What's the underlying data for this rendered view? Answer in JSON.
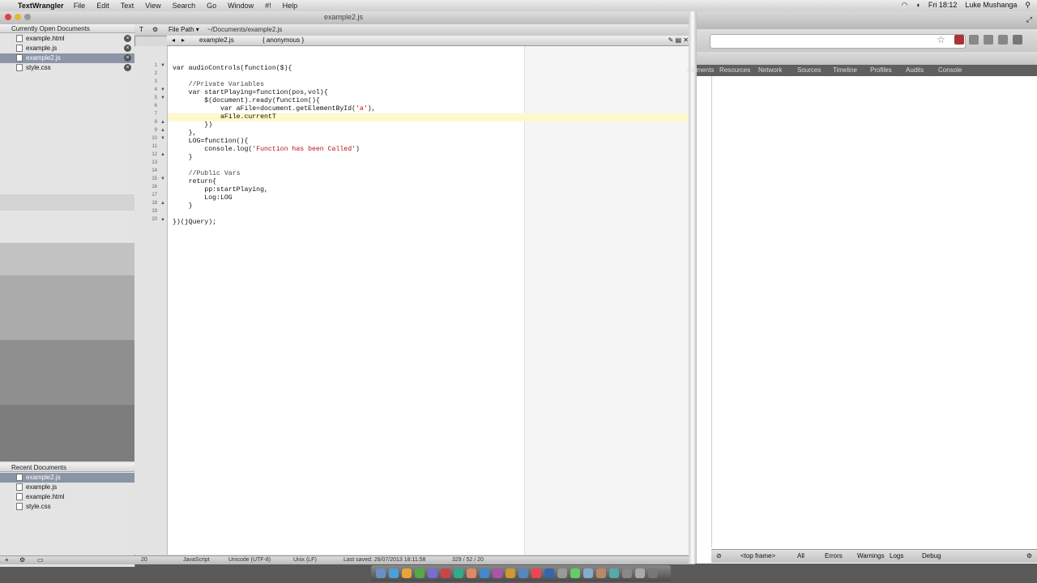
{
  "menubar": {
    "app_name": "TextWrangler",
    "items": [
      "File",
      "Edit",
      "Text",
      "View",
      "Search",
      "Go",
      "Window",
      "#!",
      "Help"
    ],
    "clock": "Fri 18:12",
    "user": "Luke Mushanga"
  },
  "window": {
    "title": "example2.js"
  },
  "sidebar": {
    "open_header": "Currently Open Documents",
    "open_docs": [
      {
        "name": "example.html",
        "selected": false
      },
      {
        "name": "example.js",
        "selected": false
      },
      {
        "name": "example2.js",
        "selected": true
      },
      {
        "name": "style.css",
        "selected": false
      }
    ],
    "recent_header": "Recent Documents",
    "recent_docs": [
      {
        "name": "example2.js",
        "selected": true
      },
      {
        "name": "example.js",
        "selected": false
      },
      {
        "name": "example.html",
        "selected": false
      },
      {
        "name": "style.css",
        "selected": false
      }
    ]
  },
  "toolbar": {
    "file_path_label": "File Path ▾",
    "file_path": "~/Documents/example2.js"
  },
  "navbar": {
    "file_menu": "example2.js",
    "function_menu": "{ anonymous }"
  },
  "editor": {
    "lines": [
      {
        "n": "1",
        "text": "var audioControls(function($){",
        "fold": "▼"
      },
      {
        "n": "2",
        "text": "",
        "fold": ""
      },
      {
        "n": "3",
        "text": "    //Private Variables",
        "fold": "",
        "cls": "cmt"
      },
      {
        "n": "4",
        "text": "    var startPlaying=function(pos,vol){",
        "fold": "▼"
      },
      {
        "n": "5",
        "text": "        $(document).ready(function(){",
        "fold": "▼"
      },
      {
        "n": "6",
        "text": "            var aFile=document.getElementById('a'),",
        "fold": ""
      },
      {
        "n": "7",
        "text": "            aFile.currentT",
        "fold": "",
        "hl": true
      },
      {
        "n": "8",
        "text": "        })",
        "fold": "▲"
      },
      {
        "n": "9",
        "text": "    },",
        "fold": "▲"
      },
      {
        "n": "10",
        "text": "    LOG=function(){",
        "fold": "▼"
      },
      {
        "n": "11",
        "text": "        console.log('Function has been Called')",
        "fold": ""
      },
      {
        "n": "12",
        "text": "    }",
        "fold": "▲"
      },
      {
        "n": "13",
        "text": "",
        "fold": ""
      },
      {
        "n": "14",
        "text": "    //Public Vars",
        "fold": "",
        "cls": "cmt"
      },
      {
        "n": "15",
        "text": "    return{",
        "fold": "▼"
      },
      {
        "n": "16",
        "text": "        pp:startPlaying,",
        "fold": ""
      },
      {
        "n": "17",
        "text": "        Log:LOG",
        "fold": ""
      },
      {
        "n": "18",
        "text": "    }",
        "fold": "▲"
      },
      {
        "n": "19",
        "text": "",
        "fold": ""
      },
      {
        "n": "20",
        "text": "})(jQuery);",
        "fold": "▲"
      }
    ]
  },
  "status": {
    "line": "20",
    "language": "JavaScript",
    "encoding": "Unicode (UTF-8)",
    "line_endings": "Unix (LF)",
    "saved": "Last saved: 26/07/2013 18:11:58",
    "counts": "329 / 52 / 20"
  },
  "devtools": {
    "tabs": [
      "Elements",
      "Resources",
      "Network",
      "Sources",
      "Timeline",
      "Profiles",
      "Audits",
      "Console"
    ],
    "frame_select": "<top frame>",
    "filters": [
      "Errors",
      "Warnings",
      "Logs",
      "Debug"
    ]
  },
  "colors": {
    "selection": "#8b95a7",
    "current_line": "#fff8cc",
    "string": "#b11"
  }
}
